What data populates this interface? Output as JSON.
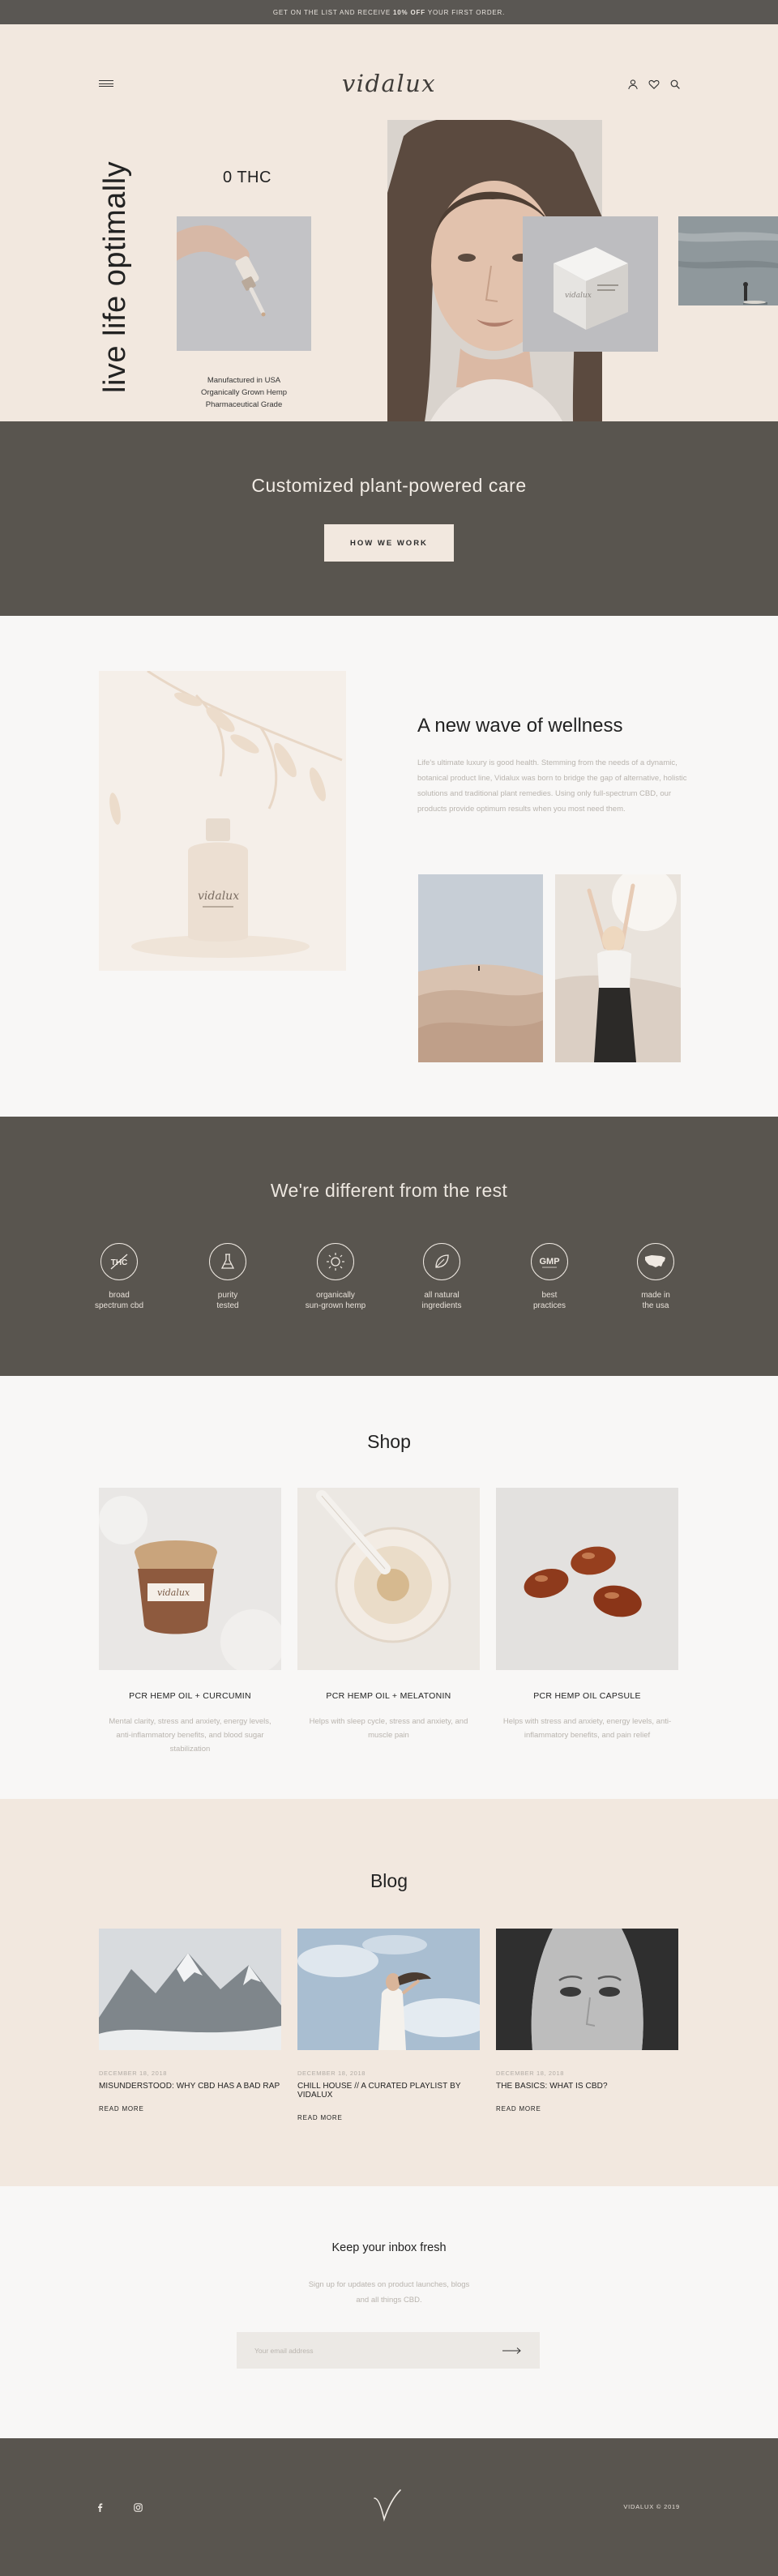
{
  "announcement": {
    "prefix": "GET ON THE LIST AND RECEIVE",
    "highlight": "10% OFF",
    "suffix": "YOUR FIRST ORDER."
  },
  "header": {
    "logo": "vidalux",
    "menu_icon": "hamburger-menu-icon",
    "icons": [
      "user-icon",
      "heart-icon",
      "search-icon"
    ]
  },
  "hero": {
    "tagline": "live life optimally",
    "badge": "0 THC",
    "meta": [
      "Manufactured in USA",
      "Organically Grown Hemp",
      "Pharmaceutical Grade"
    ]
  },
  "care": {
    "title": "Customized plant-powered care",
    "button": "HOW WE WORK"
  },
  "wellness": {
    "title": "A new wave of wellness",
    "body": "Life's ultimate luxury is good health. Stemming from the needs of a dynamic, botanical product line, Vidalux was born to bridge the gap of alternative, holistic solutions and traditional plant remedies. Using only full-spectrum CBD, our products provide optimum results when you most need them.",
    "bottle_label": "vidalux"
  },
  "different": {
    "title": "We're different from the rest",
    "features": [
      {
        "icon": "thc-free-icon",
        "line1": "broad",
        "line2": "spectrum cbd",
        "glyph": "THC"
      },
      {
        "icon": "lab-flask-icon",
        "line1": "purity",
        "line2": "tested",
        "glyph": ""
      },
      {
        "icon": "sun-icon",
        "line1": "organically",
        "line2": "sun-grown hemp",
        "glyph": ""
      },
      {
        "icon": "leaf-icon",
        "line1": "all natural",
        "line2": "ingredients",
        "glyph": ""
      },
      {
        "icon": "gmp-badge-icon",
        "line1": "best",
        "line2": "practices",
        "glyph": "GMP"
      },
      {
        "icon": "usa-map-icon",
        "line1": "made in",
        "line2": "the usa",
        "glyph": ""
      }
    ]
  },
  "shop": {
    "title": "Shop",
    "products": [
      {
        "name": "PCR HEMP OIL + CURCUMIN",
        "desc": "Mental clarity, stress and anxiety, energy levels, anti-inflammatory benefits, and blood sugar stabilization"
      },
      {
        "name": "PCR HEMP OIL + MELATONIN",
        "desc": "Helps with sleep cycle, stress and anxiety, and muscle pain"
      },
      {
        "name": "PCR HEMP OIL CAPSULE",
        "desc": "Helps with stress and anxiety, energy levels, anti-inflammatory benefits, and pain relief"
      }
    ]
  },
  "blog": {
    "title": "Blog",
    "posts": [
      {
        "date": "DECEMBER 18, 2018",
        "title": "MISUNDERSTOOD: WHY CBD HAS A BAD RAP",
        "more": "READ MORE"
      },
      {
        "date": "DECEMBER 18, 2018",
        "title": "CHILL HOUSE // A CURATED PLAYLIST BY VIDALUX",
        "more": "READ MORE"
      },
      {
        "date": "DECEMBER 18, 2018",
        "title": "THE BASICS: WHAT IS CBD?",
        "more": "READ MORE"
      }
    ]
  },
  "newsletter": {
    "title": "Keep your inbox fresh",
    "body": "Sign up for updates on product launches, blogs and all things CBD.",
    "placeholder": "Your email address"
  },
  "footer": {
    "social": [
      "facebook-icon",
      "instagram-icon"
    ],
    "copyright": "VIDALUX © 2019"
  },
  "colors": {
    "dark": "#59554f",
    "cream": "#f2e8df",
    "offwhite": "#f8f7f6",
    "muted_text": "#b9b4ae"
  }
}
